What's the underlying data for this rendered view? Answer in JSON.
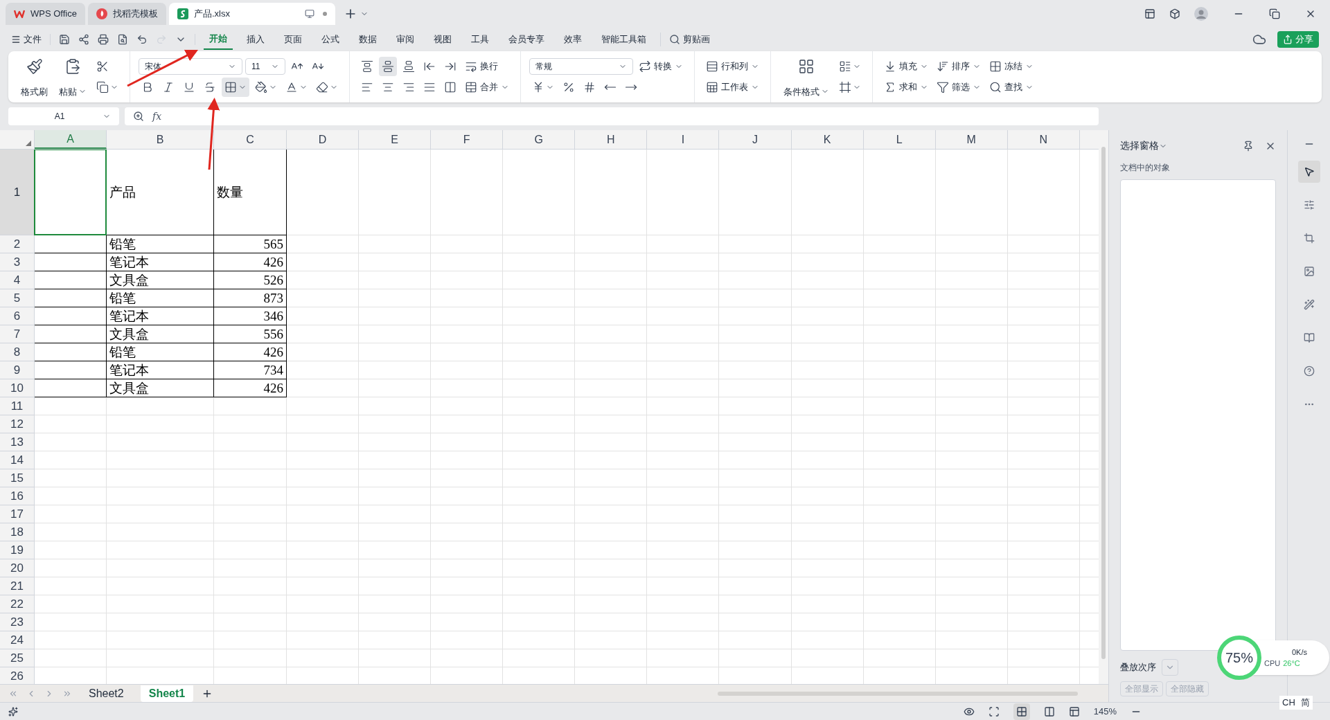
{
  "title_tabs": [
    {
      "label": "WPS Office",
      "selected": false
    },
    {
      "label": "找稻壳模板",
      "selected": false
    },
    {
      "label": "产品.xlsx",
      "selected": true
    }
  ],
  "menu": {
    "file": "文件",
    "tabs": [
      {
        "label": "开始",
        "selected": true
      },
      {
        "label": "插入",
        "selected": false
      },
      {
        "label": "页面",
        "selected": false
      },
      {
        "label": "公式",
        "selected": false
      },
      {
        "label": "数据",
        "selected": false
      },
      {
        "label": "审阅",
        "selected": false
      },
      {
        "label": "视图",
        "selected": false
      },
      {
        "label": "工具",
        "selected": false
      },
      {
        "label": "会员专享",
        "selected": false
      },
      {
        "label": "效率",
        "selected": false
      },
      {
        "label": "智能工具箱",
        "selected": false
      }
    ],
    "search": "剪贴画",
    "share": "分享"
  },
  "ribbon": [
    {
      "big": [
        {
          "kind": "big",
          "label": "格式刷",
          "menu": false
        },
        {
          "kind": "big",
          "label": "粘贴",
          "menu": true
        }
      ],
      "top": [
        {
          "kind": "icon",
          "menu": false,
          "selected": false
        }
      ],
      "bottom": [
        {
          "kind": "icon",
          "menu": true,
          "selected": false
        }
      ]
    },
    {
      "top": [
        {
          "kind": "select",
          "value": "宋体"
        },
        {
          "kind": "select",
          "value": "11"
        },
        {
          "kind": "icon",
          "menu": false,
          "selected": false
        },
        {
          "kind": "icon",
          "menu": false,
          "selected": false
        }
      ],
      "bottom": [
        {
          "kind": "icon",
          "menu": false,
          "selected": false
        },
        {
          "kind": "icon",
          "menu": false,
          "selected": false
        },
        {
          "kind": "icon",
          "menu": false,
          "selected": false
        },
        {
          "kind": "icon",
          "menu": false,
          "selected": false
        },
        {
          "kind": "icon",
          "menu": true,
          "selected": true
        },
        {
          "kind": "icon",
          "menu": true,
          "selected": false
        },
        {
          "kind": "icon",
          "menu": true,
          "selected": false
        },
        {
          "kind": "icon",
          "menu": true,
          "selected": false
        }
      ]
    },
    {
      "top": [
        {
          "kind": "icon",
          "menu": false,
          "selected": false
        },
        {
          "kind": "icon",
          "menu": false,
          "selected": true
        },
        {
          "kind": "icon",
          "menu": false,
          "selected": false
        },
        {
          "kind": "icon",
          "menu": false,
          "selected": false
        },
        {
          "kind": "icon",
          "menu": false,
          "selected": false
        },
        {
          "kind": "small",
          "label": "换行",
          "menu": false
        }
      ],
      "bottom": [
        {
          "kind": "icon",
          "menu": false,
          "selected": false
        },
        {
          "kind": "icon",
          "menu": false,
          "selected": false
        },
        {
          "kind": "icon",
          "menu": false,
          "selected": false
        },
        {
          "kind": "icon",
          "menu": false,
          "selected": false
        },
        {
          "kind": "icon",
          "menu": false,
          "selected": false
        },
        {
          "kind": "small",
          "label": "合并",
          "menu": true
        }
      ]
    },
    {
      "top": [
        {
          "kind": "select",
          "value": "常规"
        },
        {
          "kind": "small",
          "label": "转换",
          "menu": true
        }
      ],
      "bottom": [
        {
          "kind": "icon",
          "menu": true,
          "selected": false
        },
        {
          "kind": "icon",
          "menu": false,
          "selected": false
        },
        {
          "kind": "icon",
          "menu": false,
          "selected": false
        },
        {
          "kind": "icon",
          "menu": false,
          "selected": false
        },
        {
          "kind": "icon",
          "menu": false,
          "selected": false
        }
      ]
    },
    {
      "top": [
        {
          "kind": "small",
          "label": "行和列",
          "menu": true
        }
      ],
      "bottom": [
        {
          "kind": "small",
          "label": "工作表",
          "menu": true
        }
      ]
    },
    {
      "big": [
        {
          "kind": "big",
          "label": "条件格式",
          "menu": true
        }
      ],
      "top": [
        {
          "kind": "icon",
          "menu": true,
          "selected": false
        }
      ],
      "bottom": [
        {
          "kind": "icon",
          "menu": true,
          "selected": false
        }
      ]
    },
    {
      "top": [
        {
          "kind": "small",
          "label": "填充",
          "menu": true
        },
        {
          "kind": "small",
          "label": "排序",
          "menu": true
        },
        {
          "kind": "small",
          "label": "冻结",
          "menu": true
        }
      ],
      "bottom": [
        {
          "kind": "small",
          "label": "求和",
          "menu": true
        },
        {
          "kind": "small",
          "label": "筛选",
          "menu": true
        },
        {
          "kind": "small",
          "label": "查找",
          "menu": true
        }
      ]
    }
  ],
  "formula_bar": {
    "name_box": "A1",
    "fx": "fx"
  },
  "sheet": {
    "columns": [
      {
        "label": "A",
        "selected": true
      },
      {
        "label": "B",
        "selected": false
      },
      {
        "label": "C",
        "selected": false
      },
      {
        "label": "D",
        "selected": false
      },
      {
        "label": "E",
        "selected": false
      },
      {
        "label": "F",
        "selected": false
      },
      {
        "label": "G",
        "selected": false
      },
      {
        "label": "H",
        "selected": false
      },
      {
        "label": "I",
        "selected": false
      },
      {
        "label": "J",
        "selected": false
      },
      {
        "label": "K",
        "selected": false
      },
      {
        "label": "L",
        "selected": false
      },
      {
        "label": "M",
        "selected": false
      },
      {
        "label": "N",
        "selected": false
      }
    ],
    "rows": [
      {
        "number": "1",
        "selected": true,
        "kind": "header",
        "cells": [
          "产品",
          "数量"
        ]
      },
      {
        "number": "2",
        "selected": false,
        "kind": "data",
        "cells": [
          "铅笔",
          "565"
        ]
      },
      {
        "number": "3",
        "selected": false,
        "kind": "data",
        "cells": [
          "笔记本",
          "426"
        ]
      },
      {
        "number": "4",
        "selected": false,
        "kind": "data",
        "cells": [
          "文具盒",
          "526"
        ]
      },
      {
        "number": "5",
        "selected": false,
        "kind": "data",
        "cells": [
          "铅笔",
          "873"
        ]
      },
      {
        "number": "6",
        "selected": false,
        "kind": "data",
        "cells": [
          "笔记本",
          "346"
        ]
      },
      {
        "number": "7",
        "selected": false,
        "kind": "data",
        "cells": [
          "文具盒",
          "556"
        ]
      },
      {
        "number": "8",
        "selected": false,
        "kind": "data",
        "cells": [
          "铅笔",
          "426"
        ]
      },
      {
        "number": "9",
        "selected": false,
        "kind": "data",
        "cells": [
          "笔记本",
          "734"
        ]
      },
      {
        "number": "10",
        "selected": false,
        "kind": "data",
        "cells": [
          "文具盒",
          "426"
        ]
      },
      {
        "number": "11",
        "selected": false,
        "kind": "empty"
      },
      {
        "number": "12",
        "selected": false,
        "kind": "empty"
      },
      {
        "number": "13",
        "selected": false,
        "kind": "empty"
      },
      {
        "number": "14",
        "selected": false,
        "kind": "empty"
      },
      {
        "number": "15",
        "selected": false,
        "kind": "empty"
      },
      {
        "number": "16",
        "selected": false,
        "kind": "empty"
      },
      {
        "number": "17",
        "selected": false,
        "kind": "empty"
      },
      {
        "number": "18",
        "selected": false,
        "kind": "empty"
      },
      {
        "number": "19",
        "selected": false,
        "kind": "empty"
      },
      {
        "number": "20",
        "selected": false,
        "kind": "empty"
      },
      {
        "number": "21",
        "selected": false,
        "kind": "empty"
      },
      {
        "number": "22",
        "selected": false,
        "kind": "empty"
      },
      {
        "number": "23",
        "selected": false,
        "kind": "empty"
      },
      {
        "number": "24",
        "selected": false,
        "kind": "empty"
      },
      {
        "number": "25",
        "selected": false,
        "kind": "empty"
      },
      {
        "number": "26",
        "selected": false,
        "kind": "empty"
      }
    ],
    "sheet_tabs": [
      {
        "label": "Sheet2",
        "selected": false
      },
      {
        "label": "Sheet1",
        "selected": true
      }
    ]
  },
  "panel": {
    "title": "选择窗格",
    "subtitle": "文档中的对象",
    "order_label": "叠放次序",
    "buttons": [
      {
        "label": "全部显示",
        "disabled": true
      },
      {
        "label": "全部隐藏",
        "disabled": true
      }
    ]
  },
  "rail": [
    {
      "selected": true
    },
    {
      "selected": false
    },
    {
      "selected": false
    },
    {
      "selected": false
    },
    {
      "selected": false
    },
    {
      "selected": false
    },
    {
      "selected": false
    },
    {
      "selected": false
    }
  ],
  "status_bar": {
    "zoom": "145%"
  },
  "monitor_widget": {
    "percent": "75%",
    "speed": "0K/s",
    "cpu_label": "CPU",
    "temperature": "26°C"
  },
  "ime": {
    "mode": "CH",
    "script": "简"
  }
}
